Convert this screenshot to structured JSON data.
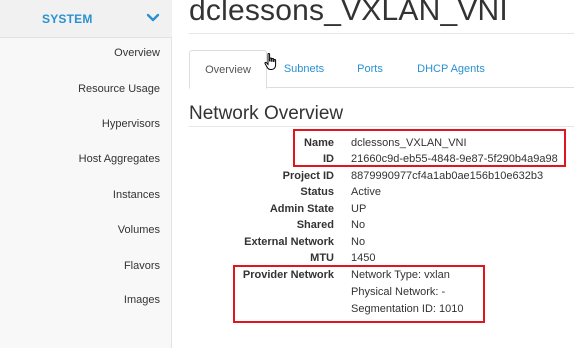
{
  "page": {
    "title": "dclessons_VXLAN_VNI",
    "section_title": "Network Overview"
  },
  "sidebar": {
    "section_label": "SYSTEM",
    "section_icon": "chevron-down-icon",
    "items": [
      {
        "label": "Overview"
      },
      {
        "label": "Resource Usage"
      },
      {
        "label": "Hypervisors"
      },
      {
        "label": "Host Aggregates"
      },
      {
        "label": "Instances"
      },
      {
        "label": "Volumes"
      },
      {
        "label": "Flavors"
      },
      {
        "label": "Images"
      }
    ]
  },
  "tabs": [
    {
      "label": "Overview",
      "active": true
    },
    {
      "label": "Subnets",
      "active": false
    },
    {
      "label": "Ports",
      "active": false
    },
    {
      "label": "DHCP Agents",
      "active": false
    }
  ],
  "details": {
    "name": {
      "label": "Name",
      "value": "dclessons_VXLAN_VNI"
    },
    "id": {
      "label": "ID",
      "value": "21660c9d-eb55-4848-9e87-5f290b4a9a98"
    },
    "project_id": {
      "label": "Project ID",
      "value": "8879990977cf4a1ab0ae156b10e632b3"
    },
    "status": {
      "label": "Status",
      "value": "Active"
    },
    "admin_state": {
      "label": "Admin State",
      "value": "UP"
    },
    "shared": {
      "label": "Shared",
      "value": "No"
    },
    "external_network": {
      "label": "External Network",
      "value": "No"
    },
    "mtu": {
      "label": "MTU",
      "value": "1450"
    },
    "provider_network": {
      "label": "Provider Network",
      "network_type": "Network Type: vxlan",
      "physical_network": "Physical Network: -",
      "segmentation_id": "Segmentation ID: 1010"
    }
  },
  "colors": {
    "link": "#2a91d0",
    "highlight_box": "#e0161f",
    "text": "#333333"
  }
}
